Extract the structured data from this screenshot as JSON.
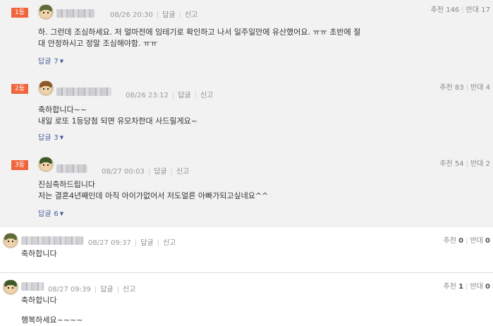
{
  "comments": [
    {
      "rank": "1등",
      "date": "08/26 20:30",
      "reply_action": "답글",
      "report_action": "신고",
      "vote_label": "추천",
      "vote_count": "146",
      "oppose_label": "반대",
      "oppose_count": "17",
      "lines": [
        "하. 그런데 조심하세요. 저 얼마전에 임테기로 확인하고 나서 일주일만에 유산했어요. ㅠㅠ 초반에 절",
        "대 안정하시고 정말 조심해야함. ㅠㅠ"
      ],
      "reply_label": "답글",
      "reply_count": "7"
    },
    {
      "rank": "2등",
      "date": "08/26 23:12",
      "reply_action": "답글",
      "report_action": "신고",
      "vote_label": "추천",
      "vote_count": "83",
      "oppose_label": "반대",
      "oppose_count": "4",
      "lines": [
        "축하합니다~~",
        "내일 로또 1등당첨 되면 유모차한대 사드릴게요~"
      ],
      "reply_label": "답글",
      "reply_count": "3"
    },
    {
      "rank": "3등",
      "date": "08/27 00:03",
      "reply_action": "답글",
      "report_action": "신고",
      "vote_label": "추천",
      "vote_count": "54",
      "oppose_label": "반대",
      "oppose_count": "2",
      "lines": [
        "진심축하드립니다",
        "저는 결혼4년째인데 아직 아이가없어서 저도얼른 아빠가되고싶네요^^"
      ],
      "reply_label": "답글",
      "reply_count": "6"
    },
    {
      "date": "08/27 09:37",
      "reply_action": "답글",
      "report_action": "신고",
      "vote_label": "추천",
      "vote_count": "0",
      "oppose_label": "반대",
      "oppose_count": "0",
      "lines": [
        "축하합니다"
      ]
    },
    {
      "date": "08/27 09:39",
      "reply_action": "답글",
      "report_action": "신고",
      "vote_label": "추천",
      "vote_count": "1",
      "oppose_label": "반대",
      "oppose_count": "0",
      "lines": [
        "축하합니다",
        "",
        "행복하세요~~~~"
      ]
    }
  ]
}
